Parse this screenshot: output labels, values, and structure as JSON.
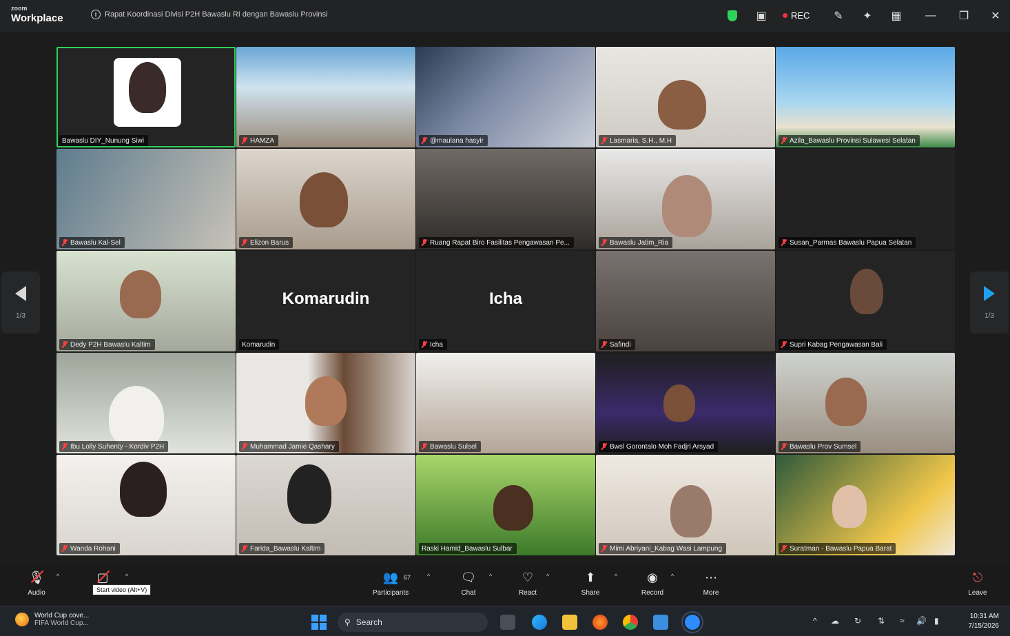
{
  "brand": {
    "line1": "zoom",
    "line2": "Workplace"
  },
  "meeting_title": "Rapat Koordinasi Divisi P2H Bawaslu RI dengan Bawaslu Provinsi",
  "title_icons": [
    "shield-icon",
    "view-icon",
    "record-icon",
    "pen-icon",
    "apps-icon",
    "grid-icon",
    "minimize-icon",
    "restore-icon",
    "close-icon"
  ],
  "rec_label": "REC",
  "tiles": [
    {
      "name": "Bawaslu DIY_Nunung Siwi",
      "muted": false,
      "active": true
    },
    {
      "name": "HAMZA",
      "muted": true
    },
    {
      "name": "@maulana hasyir",
      "muted": true
    },
    {
      "name": "Lasmaria, S.H., M.H",
      "muted": true
    },
    {
      "name": "Azila_Bawaslu Provinsi Sulawesi Selatan",
      "muted": true
    },
    {
      "name": "Bawaslu Kal-Sel",
      "muted": true
    },
    {
      "name": "Elizon Barus",
      "muted": true
    },
    {
      "name": "Ruang Rapat Biro Fasilitas Pengawasan Pe...",
      "muted": true
    },
    {
      "name": "Bawaslu Jatim_Ria",
      "muted": true
    },
    {
      "name": "Susan_Parmas Bawaslu Papua Selatan",
      "muted": true
    },
    {
      "name": "Dedy P2H Bawaslu Kaltim",
      "muted": true
    },
    {
      "name": "Komarudin",
      "muted": false,
      "display": "Komarudin"
    },
    {
      "name": "Icha",
      "muted": true,
      "display": "Icha"
    },
    {
      "name": "Safindi",
      "muted": true
    },
    {
      "name": "Supri Kabag Pengawasan Bali",
      "muted": true
    },
    {
      "name": "Ibu Lolly Suhenty - Kordiv P2H",
      "muted": true
    },
    {
      "name": "Muhammad Jamie Qashary",
      "muted": true
    },
    {
      "name": "Bawaslu Sulsel",
      "muted": true
    },
    {
      "name": "Bwsl Gorontalo Moh Fadjri Arsyad",
      "muted": true
    },
    {
      "name": "Bawaslu Prov Sumsel",
      "muted": true
    },
    {
      "name": "Wanda Rohani",
      "muted": true
    },
    {
      "name": "Farida_Bawaslu Kaltim",
      "muted": true
    },
    {
      "name": "Raski Hamid_Bawaslu Sulbar",
      "muted": false
    },
    {
      "name": "Mimi Abriyani_Kabag Wasi Lampung",
      "muted": true
    },
    {
      "name": "Suratman - Bawaslu Papua Barat",
      "muted": true
    }
  ],
  "pager": {
    "left": "1/3",
    "right": "1/3"
  },
  "toolbar": {
    "audio": "Audio",
    "video": "Video",
    "participants": "Participants",
    "participants_count": "67",
    "chat": "Chat",
    "react": "React",
    "share": "Share",
    "record": "Record",
    "more": "More",
    "leave": "Leave",
    "tooltip": "Start video (Alt+V)"
  },
  "taskbar": {
    "news_title": "World Cup cove...",
    "news_sub": "FIFA World Cup...",
    "search": "Search",
    "time": "10:31 AM",
    "date": "7/15/2026"
  },
  "colors": {
    "active_border": "#2fd15a",
    "muted_red": "#ff4040",
    "accent_blue": "#1ea2f0"
  }
}
